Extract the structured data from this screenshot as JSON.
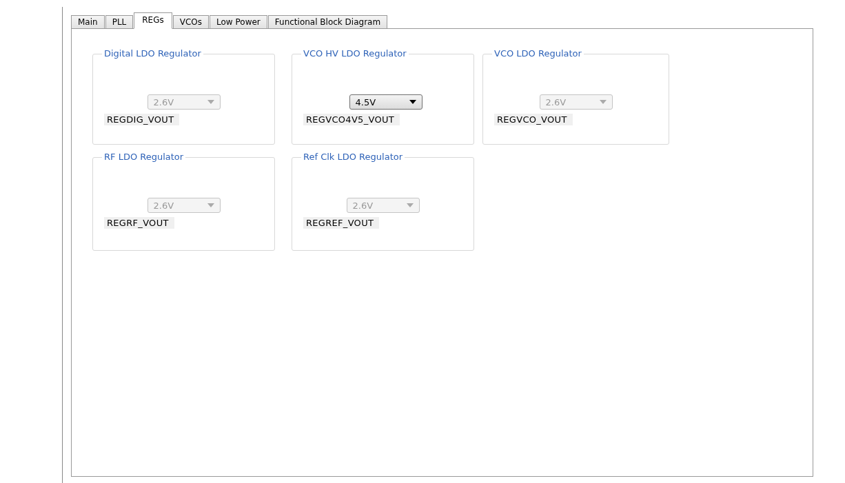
{
  "tabs": [
    {
      "label": "Main",
      "selected": false
    },
    {
      "label": "PLL",
      "selected": false
    },
    {
      "label": "REGs",
      "selected": true
    },
    {
      "label": "VCOs",
      "selected": false
    },
    {
      "label": "Low Power",
      "selected": false
    },
    {
      "label": "Functional Block Diagram",
      "selected": false
    }
  ],
  "regulators": [
    {
      "title": "Digital LDO Regulator",
      "value": "2.6V",
      "disabled": true,
      "label": "REGDIG_VOUT"
    },
    {
      "title": "VCO HV LDO Regulator",
      "value": "4.5V",
      "disabled": false,
      "label": "REGVCO4V5_VOUT"
    },
    {
      "title": "VCO LDO Regulator",
      "value": "2.6V",
      "disabled": true,
      "label": "REGVCO_VOUT"
    },
    {
      "title": "RF LDO Regulator",
      "value": "2.6V",
      "disabled": true,
      "label": "REGRF_VOUT"
    },
    {
      "title": "Ref Clk LDO Regulator",
      "value": "2.6V",
      "disabled": true,
      "label": "REGREF_VOUT"
    }
  ]
}
